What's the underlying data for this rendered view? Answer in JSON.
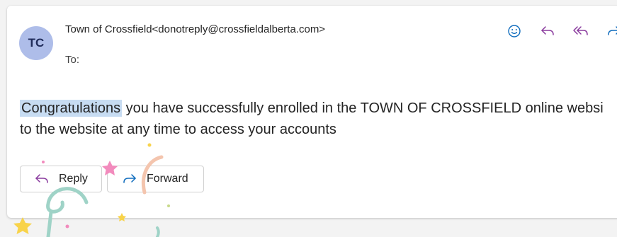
{
  "message": {
    "avatar_initials": "TC",
    "sender": "Town of Crossfield<donotreply@crossfieldalberta.com>",
    "to_label": "To:",
    "body_highlight": "Congratulations",
    "body_line1_rest": " you have successfully enrolled in the TOWN OF CROSSFIELD online websi",
    "body_line2": "to the website at any time to access your accounts"
  },
  "buttons": {
    "reply_label": "Reply",
    "forward_label": "Forward"
  },
  "header_actions": [
    "emoji-icon",
    "reply-icon",
    "reply-all-icon",
    "forward-icon"
  ],
  "colors": {
    "accent": "#0f6cbd",
    "reply_arrow": "#8a3b9e",
    "avatar_bg": "#aebde9",
    "highlight": "#c7dcf2"
  }
}
